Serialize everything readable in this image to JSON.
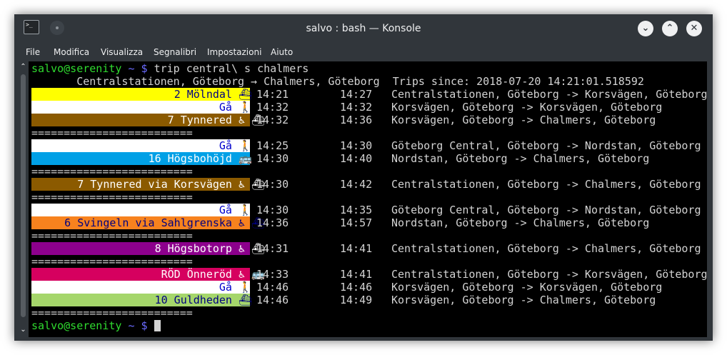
{
  "window": {
    "title": "salvo : bash — Konsole",
    "app_icon_glyph": ">_",
    "buttons": {
      "minimize": "⌄",
      "maximize": "⌃",
      "close": "✕"
    }
  },
  "menu": [
    "File",
    "Modifica",
    "Visualizza",
    "Segnalibri",
    "Impostazioni",
    "Aiuto"
  ],
  "prompt": {
    "user_host": "salvo@serenity",
    "path": "~",
    "symbol": "$",
    "command": "trip central\\ s chalmers"
  },
  "header": "       Centralstationen, Göteborg → Chalmers, Göteborg  Trips since: 2018-07-20 14:21:01.518592",
  "separator": "=========================",
  "legs": [
    {
      "label": "2 Mölndal",
      "icon": "⛴",
      "bg": "#ffff00",
      "fg": "#000080",
      "dep": "14:21",
      "arr": "14:27",
      "route": "Centralstationen, Göteborg -> Korsvägen, Göteborg"
    },
    {
      "label": "Gå",
      "icon": "🚶",
      "bg": "#ffffff",
      "fg": "#0000cc",
      "dep": "14:32",
      "arr": "14:32",
      "route": "Korsvägen, Göteborg -> Korsvägen, Göteborg"
    },
    {
      "label": "7 Tynnered",
      "icon": "♿ ⛴",
      "bg": "#8b5a00",
      "fg": "#ffffff",
      "dep": "14:32",
      "arr": "14:36",
      "route": "Korsvägen, Göteborg -> Chalmers, Göteborg"
    },
    {
      "separator": true
    },
    {
      "label": "Gå",
      "icon": "🚶",
      "bg": "#ffffff",
      "fg": "#0000cc",
      "dep": "14:25",
      "arr": "14:30",
      "route": "Göteborg Central, Göteborg -> Nordstan, Göteborg"
    },
    {
      "label": "16 Högsbohöjd",
      "icon": "🚌",
      "bg": "#00a0e6",
      "fg": "#ffffff",
      "dep": "14:30",
      "arr": "14:40",
      "route": "Nordstan, Göteborg -> Chalmers, Göteborg"
    },
    {
      "separator": true
    },
    {
      "label": "7 Tynnered via Korsvägen",
      "icon": "♿ ⛴",
      "bg": "#8b5a00",
      "fg": "#ffffff",
      "dep": "14:30",
      "arr": "14:42",
      "route": "Centralstationen, Göteborg -> Chalmers, Göteborg"
    },
    {
      "separator": true
    },
    {
      "label": "Gå",
      "icon": "🚶",
      "bg": "#ffffff",
      "fg": "#0000cc",
      "dep": "14:30",
      "arr": "14:35",
      "route": "Göteborg Central, Göteborg -> Nordstan, Göteborg"
    },
    {
      "label": "6 Svingeln via Sahlgrenska",
      "icon": "♿ ⛴",
      "bg": "#f7821e",
      "fg": "#000080",
      "dep": "14:36",
      "arr": "14:57",
      "route": "Nordstan, Göteborg -> Chalmers, Göteborg"
    },
    {
      "separator": true
    },
    {
      "label": "8 Högsbotorp",
      "icon": "♿ ⛴",
      "bg": "#8c008c",
      "fg": "#ffffff",
      "dep": "14:31",
      "arr": "14:41",
      "route": "Centralstationen, Göteborg -> Chalmers, Göteborg"
    },
    {
      "separator": true
    },
    {
      "label": "RÖD Önneröd",
      "icon": "♿ 🚌",
      "bg": "#d6005f",
      "fg": "#ffffff",
      "dep": "14:33",
      "arr": "14:41",
      "route": "Centralstationen, Göteborg -> Korsvägen, Göteborg"
    },
    {
      "label": "Gå",
      "icon": "🚶",
      "bg": "#ffffff",
      "fg": "#0000cc",
      "dep": "14:46",
      "arr": "14:46",
      "route": "Korsvägen, Göteborg -> Korsvägen, Göteborg"
    },
    {
      "label": "10 Guldheden",
      "icon": "⛴",
      "bg": "#a5d66b",
      "fg": "#000080",
      "dep": "14:46",
      "arr": "14:49",
      "route": "Korsvägen, Göteborg -> Chalmers, Göteborg"
    },
    {
      "separator": true
    }
  ],
  "final_prompt": {
    "user_host": "salvo@serenity",
    "path": "~",
    "symbol": "$"
  }
}
